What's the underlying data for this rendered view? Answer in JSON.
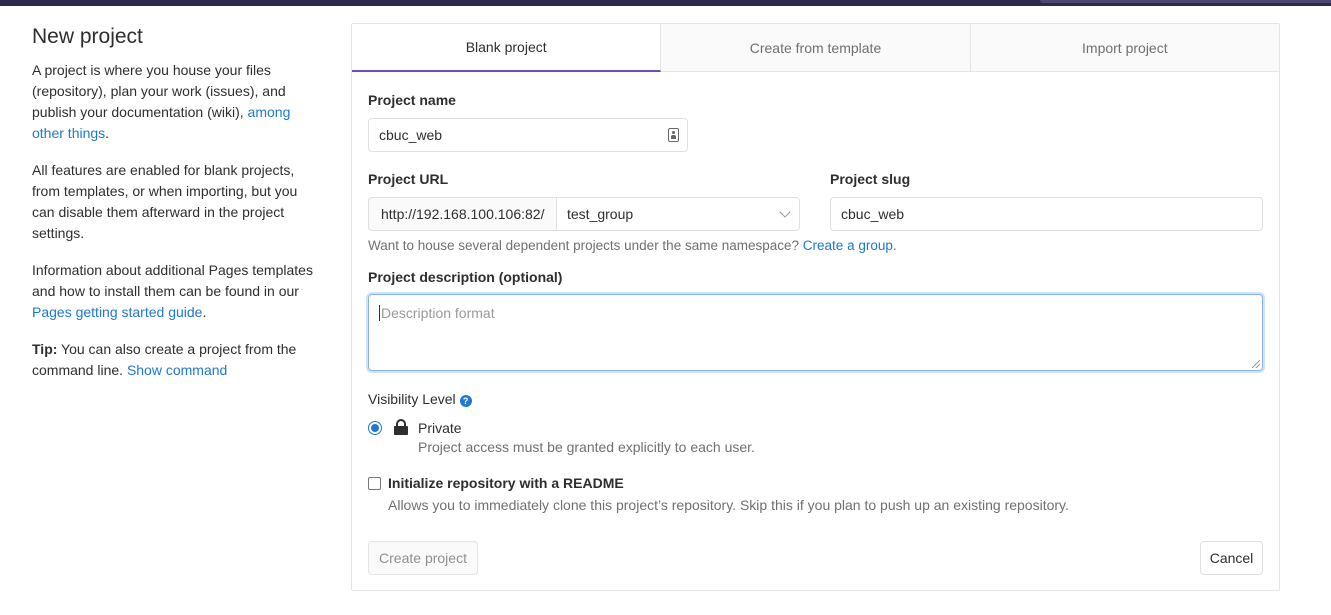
{
  "info": {
    "title": "New project",
    "p1_text": "A project is where you house your files (repository), plan your work (issues), and publish your documentation (wiki),",
    "p1_link": "among other things",
    "p1_end": ".",
    "p2_text": "All features are enabled for blank projects, from templates, or when importing, but you can disable them afterward in the project settings.",
    "p3_text": "Information about additional Pages templates and how to install them can be found in our",
    "p3_link": "Pages getting started guide",
    "p3_end": ".",
    "tip_label": "Tip:",
    "tip_text": "You can also create a project from the command line.",
    "tip_link": "Show command"
  },
  "tabs": [
    {
      "label": "Blank project",
      "active": true
    },
    {
      "label": "Create from template",
      "active": false
    },
    {
      "label": "Import project",
      "active": false
    }
  ],
  "form": {
    "project_name_label": "Project name",
    "project_name_value": "cbuc_web",
    "project_url_label": "Project URL",
    "project_url_prefix": "http://192.168.100.106:82/",
    "namespace_value": "test_group",
    "project_slug_label": "Project slug",
    "project_slug_value": "cbuc_web",
    "namespace_help": "Want to house several dependent projects under the same namespace?",
    "namespace_help_link": "Create a group.",
    "description_label": "Project description (optional)",
    "description_placeholder": "Description format",
    "visibility_label": "Visibility Level",
    "visibility_option_label": "Private",
    "visibility_option_help": "Project access must be granted explicitly to each user.",
    "readme_label": "Initialize repository with a README",
    "readme_help": "Allows you to immediately clone this project’s repository. Skip this if you plan to push up an existing repository.",
    "create_button": "Create project",
    "cancel_button": "Cancel"
  },
  "colors": {
    "accent": "#6b4fbb",
    "link": "#1f78d1",
    "topbar": "#2b2a4c"
  },
  "icons": [
    "person-card-icon",
    "chevron-down-icon",
    "question-icon",
    "lock-icon"
  ]
}
